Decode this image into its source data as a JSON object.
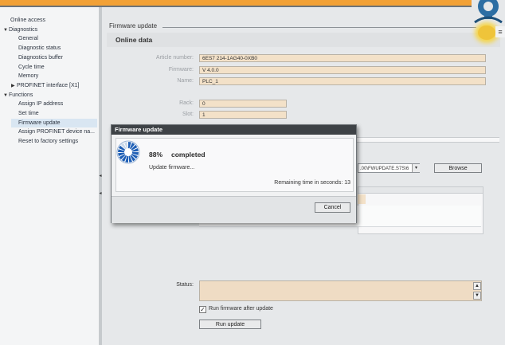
{
  "tree": {
    "items": [
      {
        "label": "Online access",
        "level": 0,
        "expand": ""
      },
      {
        "label": "Diagnostics",
        "level": 0,
        "expand": "▼"
      },
      {
        "label": "General",
        "level": 1,
        "expand": ""
      },
      {
        "label": "Diagnostic status",
        "level": 1,
        "expand": ""
      },
      {
        "label": "Diagnostics buffer",
        "level": 1,
        "expand": ""
      },
      {
        "label": "Cycle time",
        "level": 1,
        "expand": ""
      },
      {
        "label": "Memory",
        "level": 1,
        "expand": ""
      },
      {
        "label": "PROFINET interface [X1]",
        "level": 1,
        "expand": "▶"
      },
      {
        "label": "Functions",
        "level": 0,
        "expand": "▼"
      },
      {
        "label": "Assign IP address",
        "level": 1,
        "expand": ""
      },
      {
        "label": "Set time",
        "level": 1,
        "expand": ""
      },
      {
        "label": "Firmware update",
        "level": 1,
        "expand": "",
        "selected": true
      },
      {
        "label": "Assign PROFINET device na...",
        "level": 1,
        "expand": ""
      },
      {
        "label": "Reset to factory settings",
        "level": 1,
        "expand": ""
      }
    ]
  },
  "main": {
    "section_title": "Firmware update",
    "online_data_title": "Online data",
    "article_number_label": "Article number:",
    "article_number": "6ES7 214-1AG40-0XB0",
    "firmware_label": "Firmware:",
    "firmware": "V 4.0.0",
    "name_label": "Name:",
    "name": "PLC_1",
    "rack_label": "Rack:",
    "rack": "0",
    "slot_label": "Slot:",
    "slot": "1",
    "file_path": ".00\\FWUPDATE.S7S\\6",
    "browse_label": "Browse",
    "status_label": "Status:",
    "run_after_update_label": "Run firmware after update",
    "run_after_update_checked": true,
    "run_update_label": "Run update"
  },
  "dialog": {
    "title": "Firmware update",
    "percent": "88%",
    "percent_value": 0.88,
    "completed": "completed",
    "action": "Update firmware...",
    "remaining": "Remaining time in seconds: 13",
    "cancel_label": "Cancel"
  },
  "icons": {
    "tree_expand": "triangle",
    "check": "✓",
    "dropdown": "▾",
    "scroll_up": "▲",
    "scroll_down": "▼"
  },
  "colors": {
    "accent_orange": "#f2a136",
    "field_bg": "#f3e1c8",
    "dialog_title_bg": "#3e4246",
    "progress_blue": "#1f5fb5"
  }
}
